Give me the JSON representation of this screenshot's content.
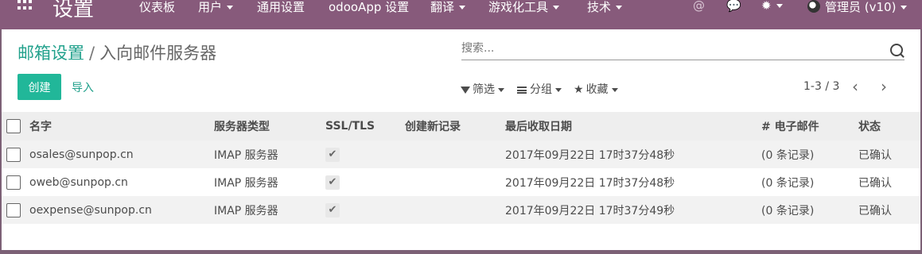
{
  "navbar": {
    "brand": "设置",
    "menus": [
      {
        "label": "仪表板",
        "dropdown": false
      },
      {
        "label": "用户",
        "dropdown": true
      },
      {
        "label": "通用设置",
        "dropdown": false
      },
      {
        "label": "odooApp 设置",
        "dropdown": false
      },
      {
        "label": "翻译",
        "dropdown": true
      },
      {
        "label": "游戏化工具",
        "dropdown": true
      },
      {
        "label": "技术",
        "dropdown": true
      }
    ],
    "at_icon": "@",
    "chat_icon": "chat-icon",
    "debug_icon": "bug-icon",
    "user_label": "管理员 (v10)"
  },
  "breadcrumb": {
    "parent": "邮箱设置",
    "separator": "/",
    "current": "入向邮件服务器"
  },
  "search": {
    "placeholder": "搜索..."
  },
  "buttons": {
    "create": "创建",
    "import": "导入"
  },
  "filters": {
    "filter": "筛选",
    "group": "分组",
    "favorite": "收藏"
  },
  "pager": {
    "range": "1-3 / 3"
  },
  "table": {
    "headers": [
      "名字",
      "服务器类型",
      "SSL/TLS",
      "创建新记录",
      "最后收取日期",
      "# 电子邮件",
      "状态"
    ],
    "rows": [
      {
        "name": "osales@sunpop.cn",
        "type": "IMAP 服务器",
        "ssl": true,
        "create": "",
        "date": "2017年09月22日 17时37分48秒",
        "emails": "(0 条记录)",
        "state": "已确认"
      },
      {
        "name": "oweb@sunpop.cn",
        "type": "IMAP 服务器",
        "ssl": true,
        "create": "",
        "date": "2017年09月22日 17时37分48秒",
        "emails": "(0 条记录)",
        "state": "已确认"
      },
      {
        "name": "oexpense@sunpop.cn",
        "type": "IMAP 服务器",
        "ssl": true,
        "create": "",
        "date": "2017年09月22日 17时37分49秒",
        "emails": "(0 条记录)",
        "state": "已确认"
      }
    ]
  },
  "colors": {
    "navbar": "#875a7b",
    "accent": "#21b799",
    "link": "#22a18c"
  }
}
